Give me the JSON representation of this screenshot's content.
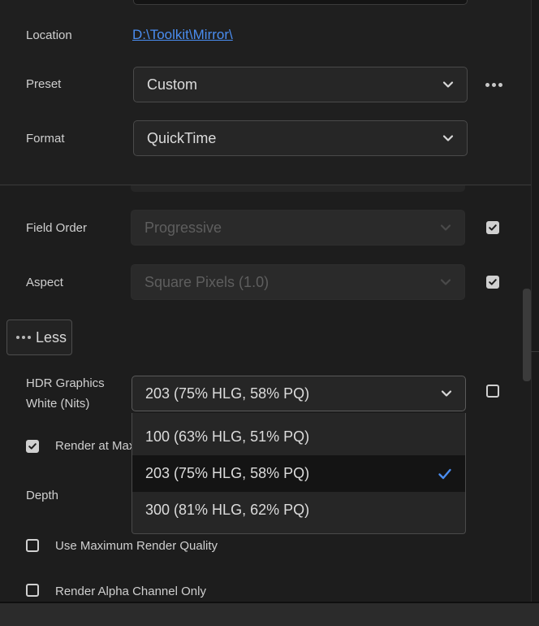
{
  "top": {
    "location_label": "Location",
    "location_value": "D:\\Toolkit\\Mirror\\",
    "preset_label": "Preset",
    "preset_value": "Custom",
    "format_label": "Format",
    "format_value": "QuickTime"
  },
  "video": {
    "field_order_label": "Field Order",
    "field_order_value": "Progressive",
    "field_order_checked": true,
    "aspect_label": "Aspect",
    "aspect_value": "Square Pixels (1.0)",
    "aspect_checked": true,
    "less_label": "Less",
    "hdr_label_line1": "HDR Graphics",
    "hdr_label_line2": "White (Nits)",
    "hdr_value": "203 (75% HLG, 58% PQ)",
    "hdr_checked": false,
    "hdr_options": [
      "100 (63% HLG, 51% PQ)",
      "203 (75% HLG, 58% PQ)",
      "300 (81% HLG, 62% PQ)"
    ],
    "hdr_selected_index": 1,
    "render_max_label": "Render at Max",
    "render_max_checked": true,
    "depth_label": "Depth",
    "max_quality_label": "Use Maximum Render Quality",
    "max_quality_checked": false,
    "alpha_only_label": "Render Alpha Channel Only",
    "alpha_only_checked": false
  },
  "icons": {
    "dropdown": "chevron-down-icon",
    "more": "more-horizontal-icon",
    "selected": "checkmark-icon"
  },
  "colors": {
    "accent": "#4a8df0",
    "background": "#1d1d1d",
    "dropdown_selected_bg": "#141414"
  }
}
